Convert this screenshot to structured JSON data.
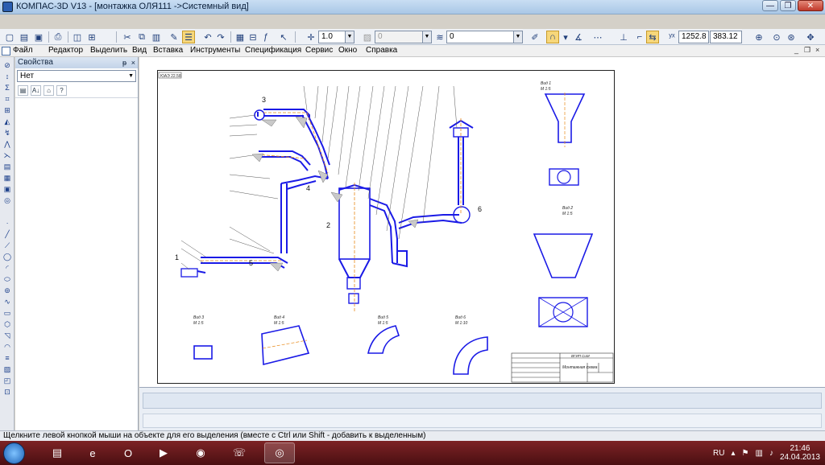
{
  "window": {
    "title": "КОМПАС-3D V13 - [монтажка ОЛЯ111 ->Системный вид]",
    "minimize": "—",
    "restore": "❐",
    "close": "✕"
  },
  "toolbar": {
    "line_scale": "1.0",
    "layer_number": "0",
    "style_value": "0",
    "coord_x": "1252.8",
    "coord_y": "383.12"
  },
  "menu": {
    "items": [
      "Файл",
      "Редактор",
      "Выделить",
      "Вид",
      "Вставка",
      "Инструменты",
      "Спецификация",
      "Сервис",
      "Окно",
      "Справка"
    ],
    "controls": [
      "_",
      "❐",
      "×"
    ]
  },
  "properties": {
    "title": "Свойства",
    "pin": "ᵽ",
    "close": "×",
    "filter_value": "Нет"
  },
  "drawing": {
    "corner_label": "ЮАЭ 22.58",
    "views": [
      {
        "title": "Вид 1",
        "scale": "М 1:5"
      },
      {
        "title": "Вид 2",
        "scale": "М 1:5"
      },
      {
        "title": "Вид 3",
        "scale": "М 1:5"
      },
      {
        "title": "Вид 4",
        "scale": "М 1:5"
      },
      {
        "title": "Вид 5",
        "scale": "М 1:5"
      },
      {
        "title": "Вид 6",
        "scale": "М 1:10"
      }
    ],
    "stamp_org": "ВГИП СиМ",
    "stamp_title": "Монтажная схема",
    "callouts": [
      "1",
      "2",
      "3",
      "4",
      "5",
      "6"
    ]
  },
  "status": {
    "text": "Щелкните левой кнопкой мыши на объекте для его выделения (вместе с Ctrl или Shift - добавить к выделенным)"
  },
  "taskbar": {
    "language": "RU",
    "time": "21:46",
    "date": "24.04.2013"
  },
  "colors": {
    "drawing_blue": "#1a1ae6",
    "axis_orange": "#e88a1a",
    "taskbar": "#6b1b1e"
  }
}
